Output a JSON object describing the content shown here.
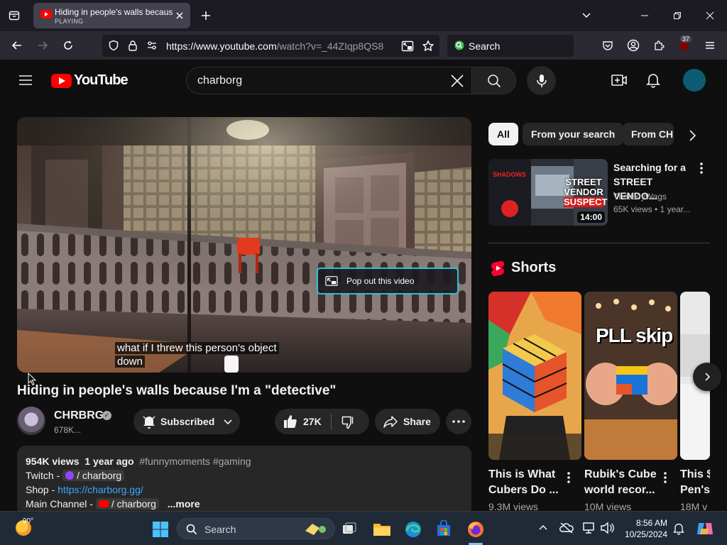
{
  "browser": {
    "tab": {
      "title": "Hiding in people's walls because I'm a \"detective\"",
      "status": "PLAYING"
    },
    "url": {
      "base": "https://www.youtube.com",
      "path": "/watch?v=_44ZIqp8QS8"
    },
    "search_placeholder": "Search",
    "extension_badge": "37"
  },
  "youtube": {
    "logo_text": "YouTube",
    "search_query": "charborg"
  },
  "video": {
    "popout_label": "Pop out this video",
    "caption_line1": "what if I threw this person's object",
    "caption_line2": "down",
    "title": "Hiding in people's walls because I'm a \"detective\"",
    "channel_name": "CHRBRG",
    "subscribers": "678K...",
    "subscribed_label": "Subscribed",
    "likes": "27K",
    "share_label": "Share"
  },
  "description": {
    "views": "954K views",
    "age": "1 year ago",
    "hashtags": "#funnymoments #gaming",
    "twitch_label": "Twitch -",
    "twitch_handle": "/ charborg",
    "shop_label": "Shop -",
    "shop_link": "https://charborg.gg/",
    "main_label": "Main Channel -",
    "main_handle": "/ charborg",
    "more_label": "...more"
  },
  "sidebar": {
    "chips": [
      "All",
      "From your search",
      "From CHRBRG"
    ],
    "recommended": {
      "title": "Searching for a STREET VENDO...",
      "channel": "ThatBoyWags",
      "meta": "65K views  • 1 year...",
      "duration": "14:00",
      "thumb_text": {
        "top": "SHADOWS",
        "line1": "STREET",
        "line2": "VENDOR",
        "line3": "SUSPECT"
      }
    },
    "shorts_heading": "Shorts",
    "shorts": [
      {
        "title1": "This is What",
        "title2": "Cubers Do ...",
        "views": "9.3M views"
      },
      {
        "title1": "Rubik's Cube",
        "title2": "world recor...",
        "views": "10M views",
        "overlay": "PLL skip"
      },
      {
        "title1": "This $",
        "title2": "Pen's",
        "views": "18M v"
      }
    ]
  },
  "taskbar": {
    "weather": "90°",
    "search_placeholder": "Search",
    "time": "8:56 AM",
    "date": "10/25/2024"
  },
  "colors": {
    "yt_red": "#ff0000",
    "link_blue": "#3ea6ff",
    "popout_border": "#2ec1d6",
    "background": "#0f0f0f"
  }
}
